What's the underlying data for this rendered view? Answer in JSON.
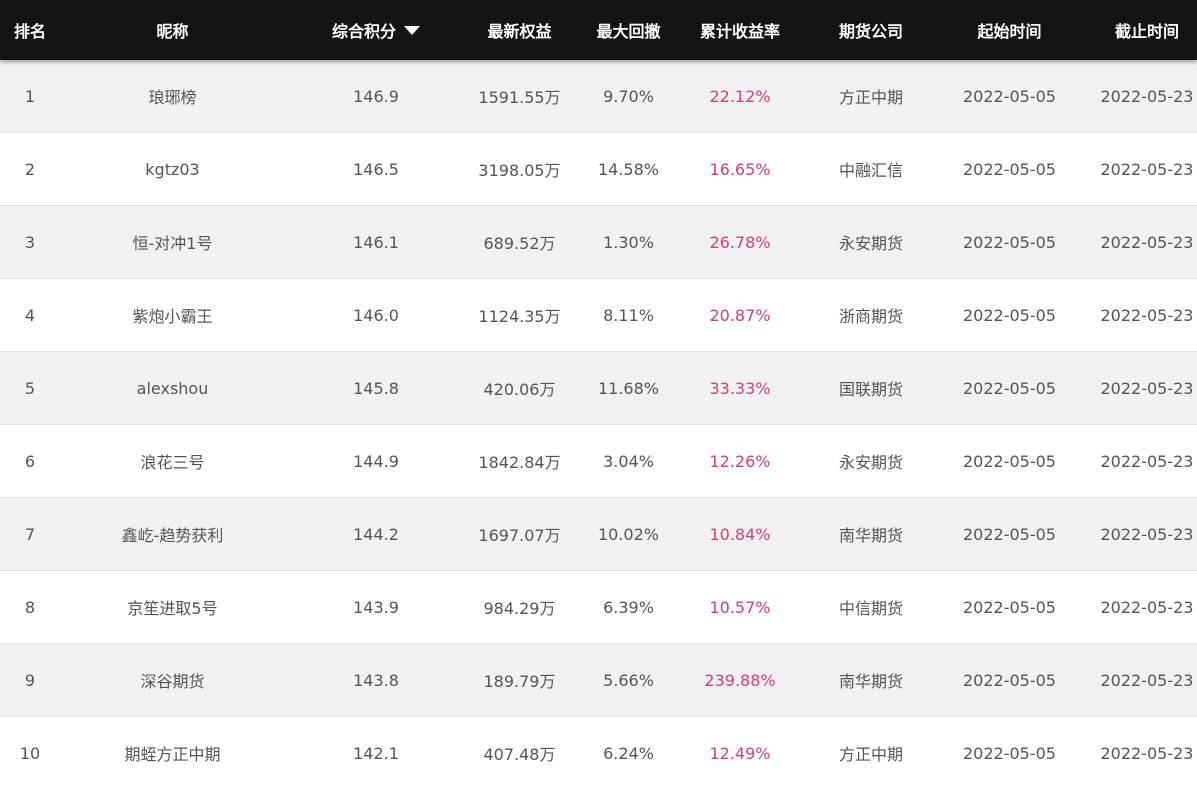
{
  "header": {
    "rank": "排名",
    "nickname": "昵称",
    "score": "综合积分",
    "equity": "最新权益",
    "drawdown": "最大回撤",
    "return_rate": "累计收益率",
    "company": "期货公司",
    "start_time": "起始时间",
    "end_time": "截止时间"
  },
  "colors": {
    "header_bg": "#141414",
    "odd_row_bg": "#f1f1f1",
    "return_rate_text": "#e23b7a"
  },
  "rows": [
    {
      "rank": "1",
      "nickname": "琅琊榜",
      "score": "146.9",
      "equity": "1591.55万",
      "drawdown": "9.70%",
      "return_rate": "22.12%",
      "company": "方正中期",
      "start": "2022-05-05",
      "end": "2022-05-23"
    },
    {
      "rank": "2",
      "nickname": "kgtz03",
      "score": "146.5",
      "equity": "3198.05万",
      "drawdown": "14.58%",
      "return_rate": "16.65%",
      "company": "中融汇信",
      "start": "2022-05-05",
      "end": "2022-05-23"
    },
    {
      "rank": "3",
      "nickname": "恒-对冲1号",
      "score": "146.1",
      "equity": "689.52万",
      "drawdown": "1.30%",
      "return_rate": "26.78%",
      "company": "永安期货",
      "start": "2022-05-05",
      "end": "2022-05-23"
    },
    {
      "rank": "4",
      "nickname": "紫炮小霸王",
      "score": "146.0",
      "equity": "1124.35万",
      "drawdown": "8.11%",
      "return_rate": "20.87%",
      "company": "浙商期货",
      "start": "2022-05-05",
      "end": "2022-05-23"
    },
    {
      "rank": "5",
      "nickname": "alexshou",
      "score": "145.8",
      "equity": "420.06万",
      "drawdown": "11.68%",
      "return_rate": "33.33%",
      "company": "国联期货",
      "start": "2022-05-05",
      "end": "2022-05-23"
    },
    {
      "rank": "6",
      "nickname": "浪花三号",
      "score": "144.9",
      "equity": "1842.84万",
      "drawdown": "3.04%",
      "return_rate": "12.26%",
      "company": "永安期货",
      "start": "2022-05-05",
      "end": "2022-05-23"
    },
    {
      "rank": "7",
      "nickname": "鑫屹-趋势获利",
      "score": "144.2",
      "equity": "1697.07万",
      "drawdown": "10.02%",
      "return_rate": "10.84%",
      "company": "南华期货",
      "start": "2022-05-05",
      "end": "2022-05-23"
    },
    {
      "rank": "8",
      "nickname": "京笙进取5号",
      "score": "143.9",
      "equity": "984.29万",
      "drawdown": "6.39%",
      "return_rate": "10.57%",
      "company": "中信期货",
      "start": "2022-05-05",
      "end": "2022-05-23"
    },
    {
      "rank": "9",
      "nickname": "深谷期货",
      "score": "143.8",
      "equity": "189.79万",
      "drawdown": "5.66%",
      "return_rate": "239.88%",
      "company": "南华期货",
      "start": "2022-05-05",
      "end": "2022-05-23"
    },
    {
      "rank": "10",
      "nickname": "期蛭方正中期",
      "score": "142.1",
      "equity": "407.48万",
      "drawdown": "6.24%",
      "return_rate": "12.49%",
      "company": "方正中期",
      "start": "2022-05-05",
      "end": "2022-05-23"
    }
  ]
}
